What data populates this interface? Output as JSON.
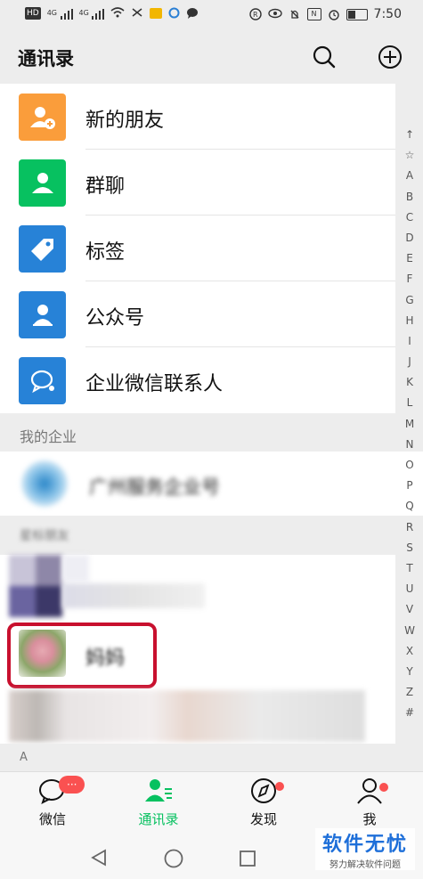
{
  "status_bar": {
    "left_icons": [
      "hd-icon",
      "signal-4g-icon",
      "signal-4g-icon",
      "wifi-icon",
      "no-sim-icon",
      "mail-notification-icon",
      "browser-icon",
      "chat-bubble-icon"
    ],
    "right_icons": [
      "nfc-icon",
      "eye-icon",
      "mute-icon",
      "nfc-n-icon",
      "alarm-icon",
      "battery-icon"
    ],
    "hd_label": "HD",
    "net1": "4G",
    "net2": "4G",
    "time": "7:50"
  },
  "header": {
    "title": "通讯录",
    "search_icon": "search-icon",
    "add_icon": "plus-circle-icon"
  },
  "top_items": [
    {
      "label": "新的朋友",
      "icon": "add-friend-icon",
      "color": "#fa9d3b"
    },
    {
      "label": "群聊",
      "icon": "group-chat-icon",
      "color": "#07c160"
    },
    {
      "label": "标签",
      "icon": "tag-icon",
      "color": "#2782d7"
    },
    {
      "label": "公众号",
      "icon": "official-account-icon",
      "color": "#2782d7"
    },
    {
      "label": "企业微信联系人",
      "icon": "work-contacts-icon",
      "color": "#2782d7"
    }
  ],
  "my_company": {
    "header": "我的企业",
    "name": "广州服务企业号"
  },
  "star_section_header": "星标朋友",
  "highlighted_contact": {
    "name": "妈妈"
  },
  "section_letter": "A",
  "alphabet": [
    "↑",
    "☆",
    "A",
    "B",
    "C",
    "D",
    "E",
    "F",
    "G",
    "H",
    "I",
    "J",
    "K",
    "L",
    "M",
    "N",
    "O",
    "P",
    "Q",
    "R",
    "S",
    "T",
    "U",
    "V",
    "W",
    "X",
    "Y",
    "Z",
    "#"
  ],
  "tabs": [
    {
      "label": "微信",
      "icon": "chat-icon",
      "badge": "···"
    },
    {
      "label": "通讯录",
      "icon": "contacts-icon",
      "active": true
    },
    {
      "label": "发现",
      "icon": "compass-icon"
    },
    {
      "label": "我",
      "icon": "profile-icon"
    }
  ],
  "watermark": {
    "main": "软件无忧",
    "sub": "努力解决软件问题"
  }
}
